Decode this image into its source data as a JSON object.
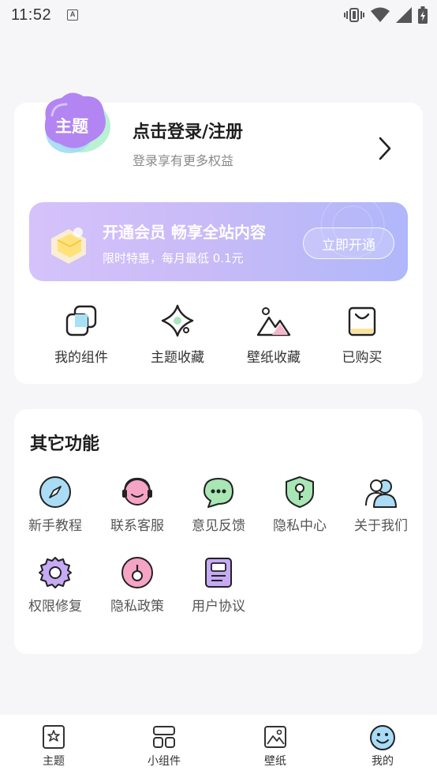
{
  "status_bar": {
    "time": "11:52",
    "notification_letter": "A",
    "icons": [
      "vibrate-icon",
      "wifi-icon",
      "signal-icon",
      "battery-charging-icon"
    ]
  },
  "profile": {
    "avatar_text": "主题",
    "title": "点击登录/注册",
    "subtitle": "登录享有更多权益"
  },
  "vip": {
    "title": "开通会员 畅享全站内容",
    "subtitle": "限时特惠，每月最低 0.1元",
    "button": "立即开通"
  },
  "quick_actions": [
    {
      "label": "我的组件",
      "icon": "widgets-icon"
    },
    {
      "label": "主题收藏",
      "icon": "sparkle-icon"
    },
    {
      "label": "壁纸收藏",
      "icon": "mountain-icon"
    },
    {
      "label": "已购买",
      "icon": "bag-icon"
    }
  ],
  "other": {
    "title": "其它功能",
    "items": [
      {
        "label": "新手教程",
        "icon": "compass-icon"
      },
      {
        "label": "联系客服",
        "icon": "headset-icon"
      },
      {
        "label": "意见反馈",
        "icon": "chat-bubble-icon"
      },
      {
        "label": "隐私中心",
        "icon": "shield-key-icon"
      },
      {
        "label": "关于我们",
        "icon": "users-icon"
      },
      {
        "label": "权限修复",
        "icon": "gear-icon"
      },
      {
        "label": "隐私政策",
        "icon": "lock-icon"
      },
      {
        "label": "用户协议",
        "icon": "document-icon"
      }
    ]
  },
  "bottom_nav": [
    {
      "label": "主题",
      "icon": "theme-icon",
      "active": false
    },
    {
      "label": "小组件",
      "icon": "widget-icon",
      "active": false
    },
    {
      "label": "壁纸",
      "icon": "wallpaper-icon",
      "active": false
    },
    {
      "label": "我的",
      "icon": "smile-icon",
      "active": true
    }
  ],
  "colors": {
    "background": "#f6f6f8",
    "vip_gradient_start": "#d5c2fb",
    "vip_gradient_end": "#b0b7fa",
    "accent_purple": "#b78df5",
    "accent_blue": "#8dd3f4",
    "accent_green": "#9fe0a9",
    "accent_pink": "#f5a0c4"
  }
}
